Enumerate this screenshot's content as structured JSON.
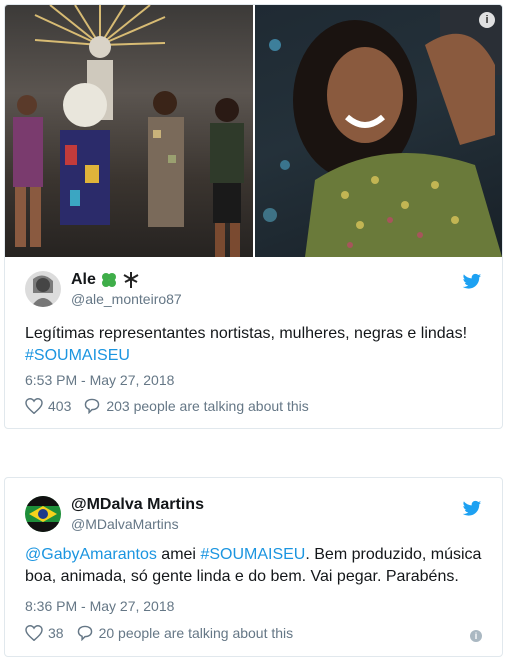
{
  "tweets": [
    {
      "display_name": "Ale",
      "handle": "@ale_monteiro87",
      "text_plain": "Legítimas representantes nortistas, mulheres, negras e lindas!",
      "hashtag": "#SOUMAISEU",
      "timestamp": "6:53 PM - May 27, 2018",
      "likes": "403",
      "talking": "203 people are talking about this"
    },
    {
      "display_name": "@MDalva Martins",
      "handle": "@MDalvaMartins",
      "mention": "@GabyAmarantos",
      "text_mid": " amei ",
      "hashtag": "#SOUMAISEU",
      "text_rest": ". Bem produzido, música boa, animada, só gente linda e do bem. Vai pegar. Parabéns.",
      "timestamp": "8:36 PM - May 27, 2018",
      "likes": "38",
      "talking": "20 people are talking about this"
    }
  ],
  "icons": {
    "info": "i",
    "twitter": "twitter-bird-icon",
    "heart": "heart-icon",
    "reply": "speech-bubble-icon",
    "emoji_clover": "four-leaf-clover-icon",
    "emoji_palm": "palm-tree-icon"
  },
  "colors": {
    "link": "#1b95e0",
    "twitter_blue": "#1da1f2",
    "secondary_text": "#657786",
    "border": "#e1e8ed",
    "clover_green": "#3fae49"
  }
}
